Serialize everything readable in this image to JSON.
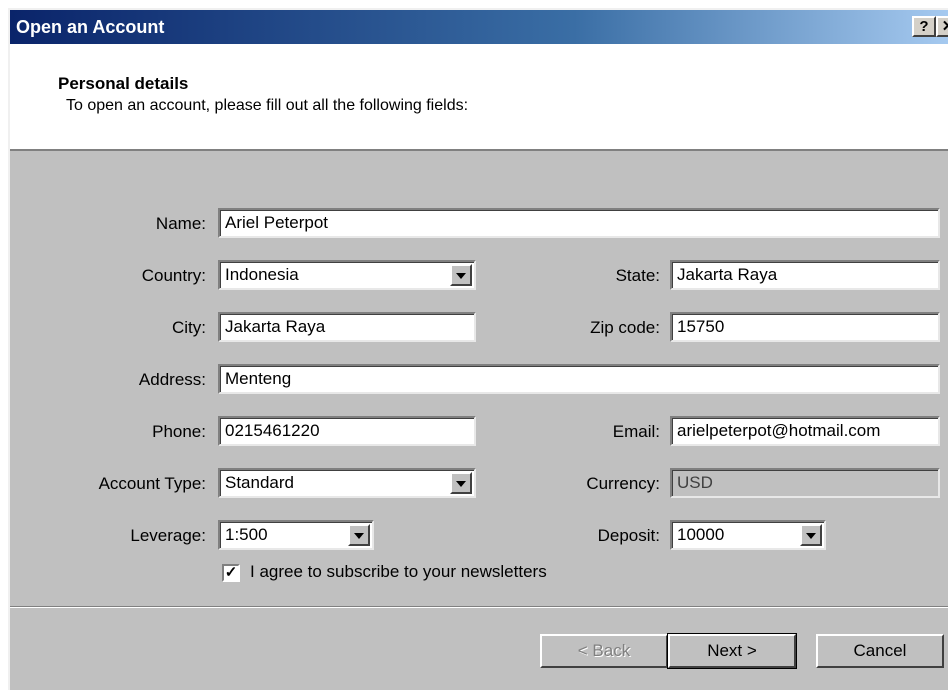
{
  "window": {
    "title": "Open an Account",
    "help_label": "?",
    "close_label": "✕"
  },
  "header": {
    "title": "Personal details",
    "subtitle": "To open an account, please fill out all the following fields:"
  },
  "form": {
    "name": {
      "label": "Name:",
      "value": "Ariel Peterpot"
    },
    "country": {
      "label": "Country:",
      "value": "Indonesia"
    },
    "state": {
      "label": "State:",
      "value": "Jakarta Raya"
    },
    "city": {
      "label": "City:",
      "value": "Jakarta Raya"
    },
    "zip": {
      "label": "Zip code:",
      "value": "15750"
    },
    "address": {
      "label": "Address:",
      "value": "Menteng"
    },
    "phone": {
      "label": "Phone:",
      "value": "0215461220"
    },
    "email": {
      "label": "Email:",
      "value": "arielpeterpot@hotmail.com"
    },
    "account_type": {
      "label": "Account Type:",
      "value": "Standard"
    },
    "currency": {
      "label": "Currency:",
      "value": "USD"
    },
    "leverage": {
      "label": "Leverage:",
      "value": "1:500"
    },
    "deposit": {
      "label": "Deposit:",
      "value": "10000"
    },
    "newsletter": {
      "label": "I agree to subscribe to your newsletters",
      "checked": true,
      "check_glyph": "✓"
    }
  },
  "buttons": {
    "back": "< Back",
    "next": "Next >",
    "cancel": "Cancel"
  }
}
